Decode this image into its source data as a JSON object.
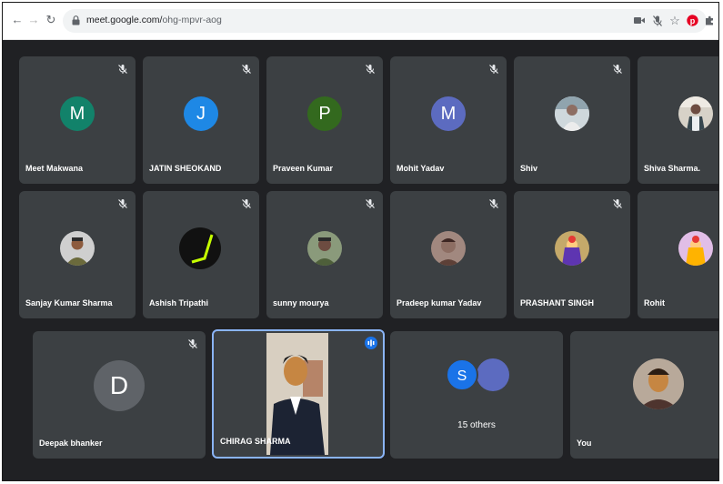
{
  "browser": {
    "url_host": "meet.google.com/",
    "url_path": "ohg-mpvr-aog"
  },
  "participants": [
    {
      "name": "Meet Makwana",
      "initial": "M",
      "color": "#12826a",
      "muted": true
    },
    {
      "name": "JATIN SHEOKAND",
      "initial": "J",
      "color": "#1e88e5",
      "muted": true
    },
    {
      "name": "Praveen Kumar",
      "initial": "P",
      "color": "#33691e",
      "muted": true
    },
    {
      "name": "Mohit Yadav",
      "initial": "M",
      "color": "#5c6bc0",
      "muted": true
    },
    {
      "name": "Shiv",
      "muted": true
    },
    {
      "name": "Shiva Sharma.",
      "muted": false
    },
    {
      "name": "Sanjay Kumar Sharma",
      "muted": true
    },
    {
      "name": "Ashish Tripathi",
      "muted": true
    },
    {
      "name": "sunny mourya",
      "muted": true
    },
    {
      "name": "Pradeep kumar Yadav",
      "muted": true
    },
    {
      "name": "PRASHANT SINGH",
      "muted": true
    },
    {
      "name": "Rohit",
      "muted": false
    },
    {
      "name": "Deepak bhanker",
      "initial": "D",
      "color": "#5f6368",
      "muted": true
    },
    {
      "name": "CHIRAG SHARMA",
      "muted": false,
      "speaking": true
    },
    {
      "name": "You",
      "muted": false
    }
  ],
  "others": {
    "initial": "S",
    "color": "#1a73e8",
    "label": "15 others"
  }
}
